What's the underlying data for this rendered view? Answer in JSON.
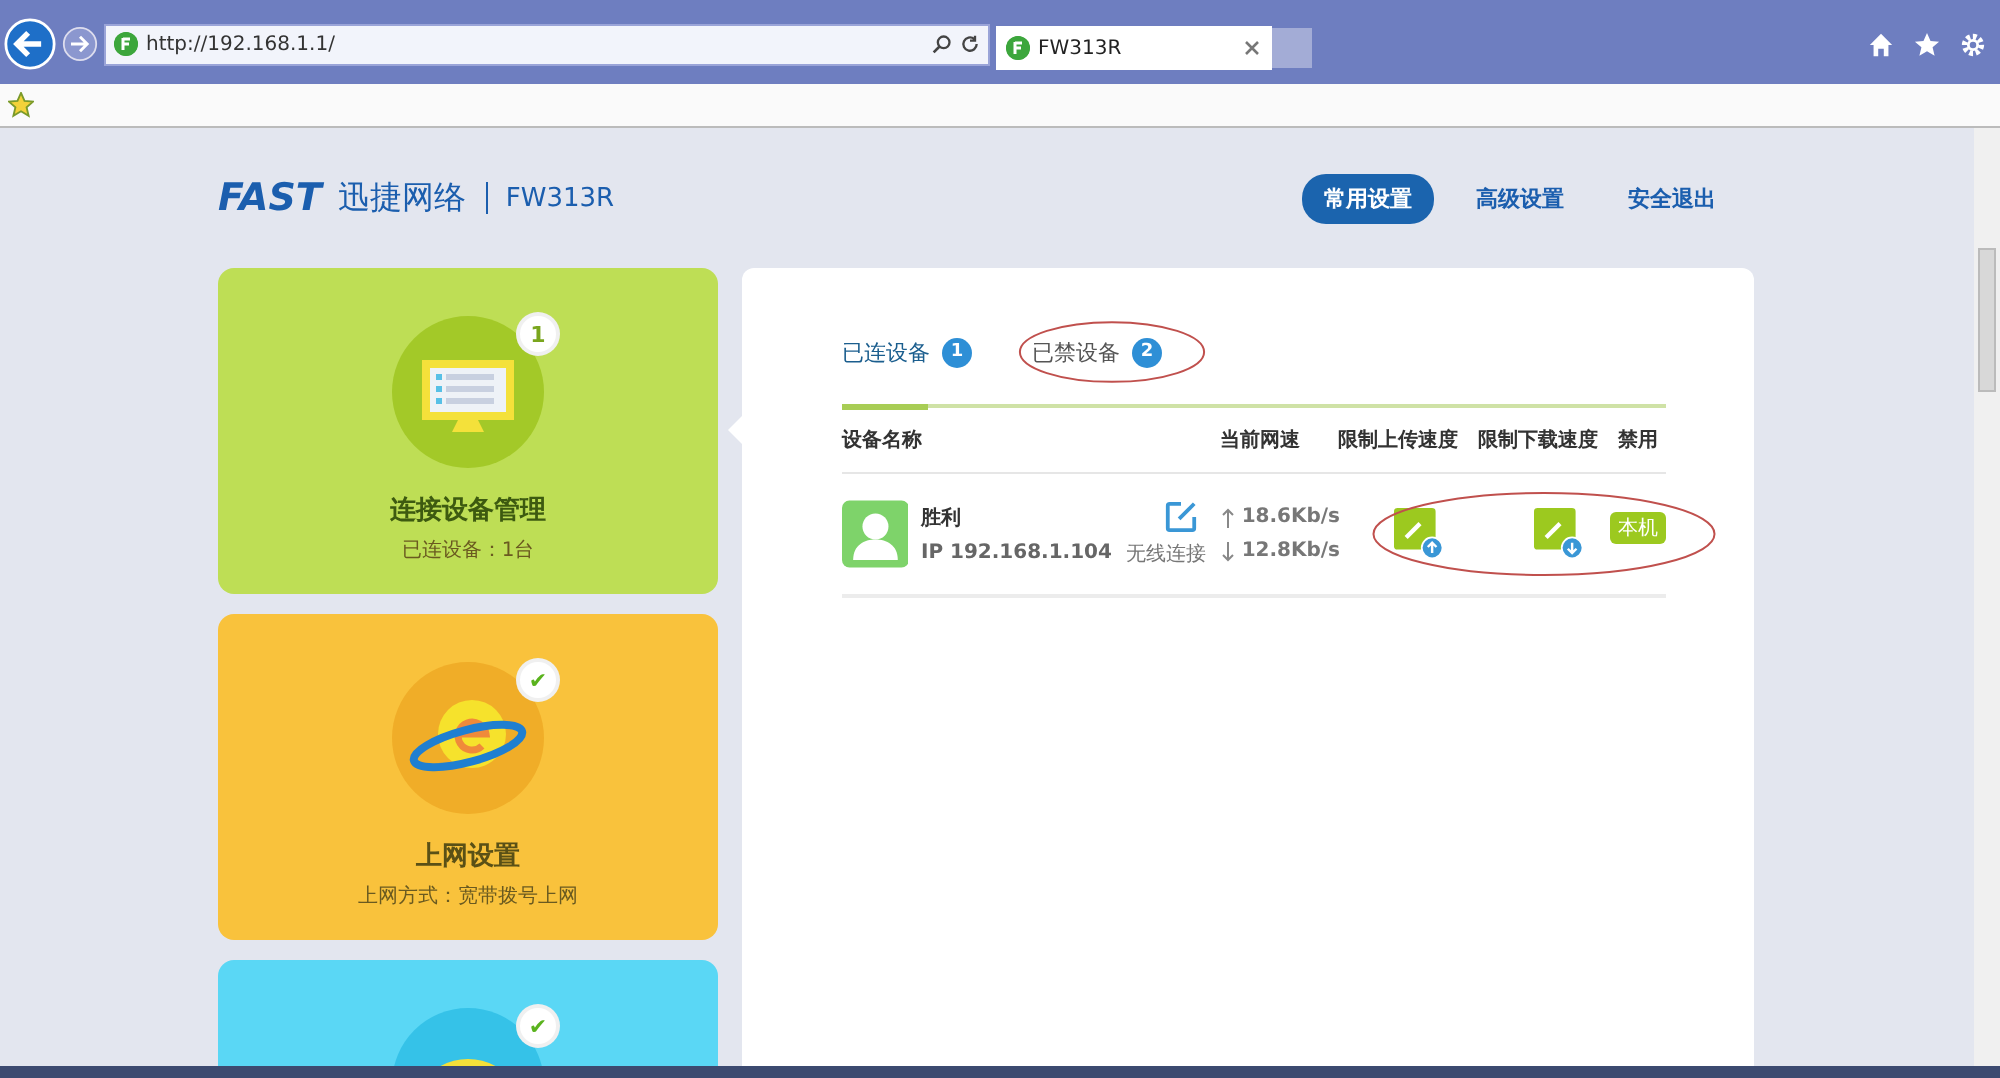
{
  "browser": {
    "url": "http://192.168.1.1/",
    "tab_title": "FW313R"
  },
  "header": {
    "brand": "FAST",
    "brand_cn": "迅捷网络",
    "model": "FW313R",
    "nav": [
      {
        "label": "常用设置",
        "selected": true
      },
      {
        "label": "高级设置",
        "selected": false
      },
      {
        "label": "安全退出",
        "selected": false
      }
    ]
  },
  "cards": [
    {
      "kind": "devices",
      "color": "#bede55",
      "badge": "1",
      "title": "连接设备管理",
      "subtitle": "已连设备：1台"
    },
    {
      "kind": "internet",
      "color": "#f9c23c",
      "badge": "✔",
      "title": "上网设置",
      "subtitle": "上网方式：宽带拨号上网"
    },
    {
      "kind": "wifi",
      "color": "#5ad7f5",
      "badge": "✔"
    }
  ],
  "panel": {
    "tabs": [
      {
        "label": "已连设备",
        "count": "1",
        "selected": true
      },
      {
        "label": "已禁设备",
        "count": "2",
        "selected": false
      }
    ],
    "columns": [
      "设备名称",
      "当前网速",
      "限制上传速度",
      "限制下载速度",
      "禁用"
    ],
    "rows": [
      {
        "name": "胜利",
        "ip": "IP 192.168.1.104",
        "connection": "无线连接",
        "upload": "18.6Kb/s",
        "download": "12.8Kb/s",
        "tag": "本机"
      }
    ]
  }
}
